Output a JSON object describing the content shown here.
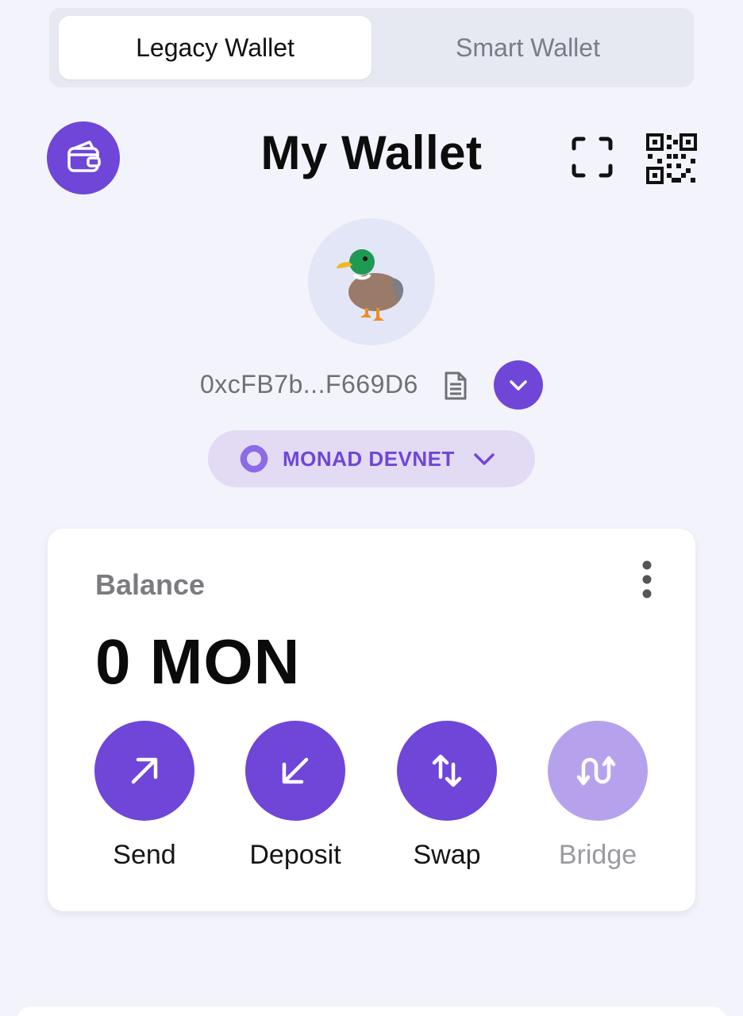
{
  "tabs": {
    "legacy_label": "Legacy Wallet",
    "smart_label": "Smart Wallet",
    "active": "legacy"
  },
  "header": {
    "title": "My Wallet",
    "left_icon": "wallet-icon",
    "scan_icon": "scan-icon",
    "qr_icon": "qr-code-icon"
  },
  "account": {
    "avatar_emoji": "🦆",
    "address": "0xcFB7b...F669D6",
    "copy_icon": "copy-icon",
    "expand_icon": "chevron-down-icon"
  },
  "network": {
    "label": "MONAD DEVNET",
    "icon": "monad-logo-icon"
  },
  "balance": {
    "label": "Balance",
    "value": "0 MON"
  },
  "actions": [
    {
      "label": "Send",
      "icon": "arrow-up-right-icon",
      "enabled": true
    },
    {
      "label": "Deposit",
      "icon": "arrow-down-left-icon",
      "enabled": true
    },
    {
      "label": "Swap",
      "icon": "swap-vertical-icon",
      "enabled": true
    },
    {
      "label": "Bridge",
      "icon": "bridge-icon",
      "enabled": false
    }
  ],
  "colors": {
    "accent": "#6f46d8",
    "accent_disabled": "#b6a2ec",
    "background": "#f3f4fb",
    "pill_bg": "#e3daf4"
  }
}
